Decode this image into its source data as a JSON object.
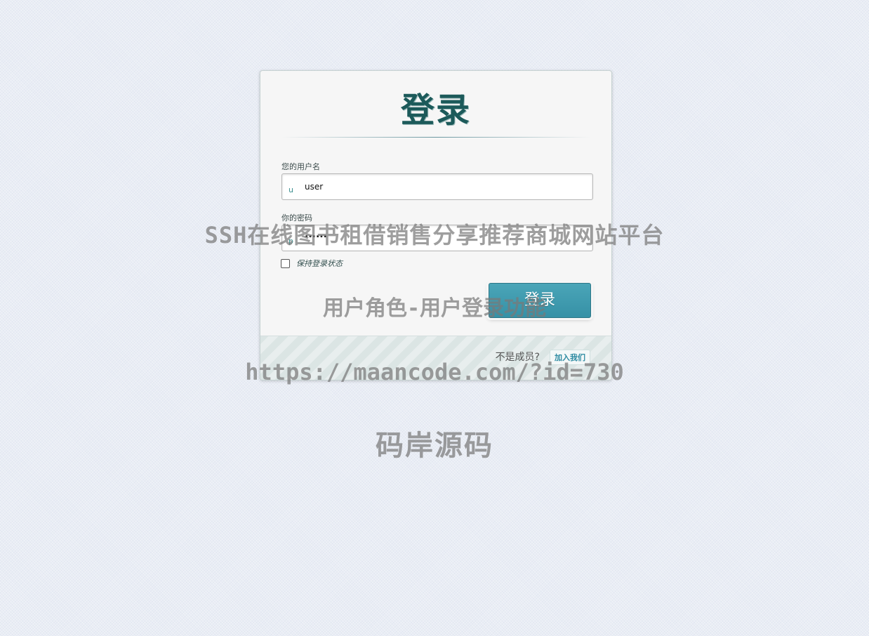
{
  "login": {
    "title": "登录",
    "username_label": "您的用户名",
    "username_icon": "u",
    "username_value": "user",
    "password_label": "你的密码",
    "password_icon": "p",
    "password_value": "......",
    "remember_label": "保持登录状态",
    "submit_label": "登录",
    "not_member_text": "不是成员?",
    "join_label": "加入我们"
  },
  "watermarks": {
    "line1": "SSH在线图书租借销售分享推荐商城网站平台",
    "line2": "用户角色-用户登录功能",
    "line3": "https://maancode.com/?id=730",
    "line4": "码岸源码"
  },
  "colors": {
    "accent": "#3a9ab0",
    "title": "#1c5a5a"
  }
}
